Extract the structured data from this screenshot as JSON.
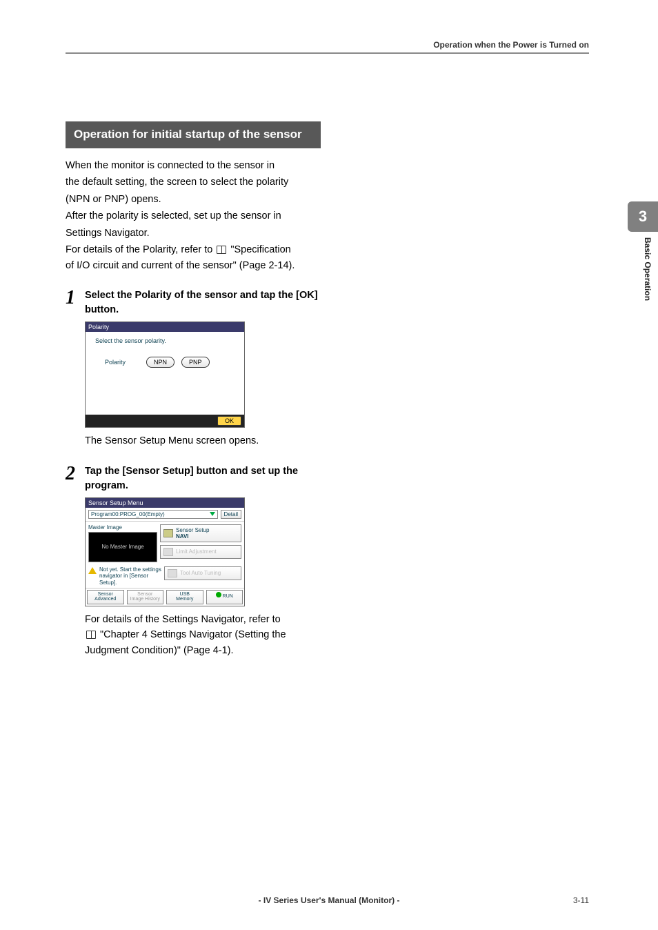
{
  "header": {
    "running": "Operation when the Power is Turned on"
  },
  "sidebar": {
    "chapter_num": "3",
    "chapter_label": "Basic Operation"
  },
  "section": {
    "title": "Operation for initial startup of the sensor"
  },
  "intro": {
    "p1a": "When the monitor is connected to the sensor in",
    "p1b": "the default setting, the screen to select the polarity",
    "p1c": "(NPN or PNP) opens.",
    "p2a": "After the polarity is selected, set up the sensor in",
    "p2b": "Settings Navigator.",
    "p3a": "For details of the Polarity, refer to ",
    "p3b": " \"Specification",
    "p3c": "of I/O circuit and current of the sensor\" (Page 2-14)."
  },
  "steps": [
    {
      "num": "1",
      "text": "Select the Polarity of the sensor and tap the [OK] button.",
      "after": "The Sensor Setup Menu screen opens."
    },
    {
      "num": "2",
      "text": "Tap the [Sensor Setup] button and set up the program.",
      "after_a": "For details of the Settings Navigator, refer to ",
      "after_b": " \"Chapter 4  Settings Navigator (Setting the",
      "after_c": "Judgment Condition)\" (Page 4-1)."
    }
  ],
  "polshot": {
    "title": "Polarity",
    "instr": "Select the sensor polarity.",
    "label": "Polarity",
    "npn": "NPN",
    "pnp": "PNP",
    "ok": "OK"
  },
  "ssmshot": {
    "title": "Sensor Setup Menu",
    "prog": "Program00:PROG_00(Empty)",
    "detail": "Detail",
    "master_image": "Master Image",
    "no_master": "No Master Image",
    "sensor_setup": "Sensor Setup",
    "navi": "NAVI",
    "limit": "Limit Adjustment",
    "tuning": "Tool Auto Tuning",
    "warn": "Not yet. Start the settings navigator in [Sensor Setup].",
    "tabs": {
      "t1a": "Sensor",
      "t1b": "Advanced",
      "t2a": "Sensor",
      "t2b": "Image History",
      "t3a": "USB",
      "t3b": "Memory",
      "t4": "RUN"
    }
  },
  "footer": {
    "center": "- IV Series User's Manual (Monitor) -",
    "pageno": "3-11"
  }
}
